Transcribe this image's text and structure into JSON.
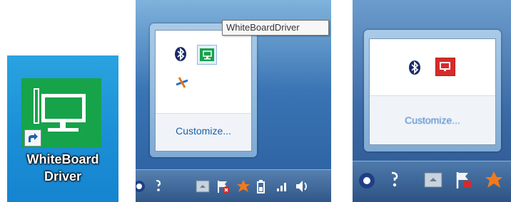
{
  "desktop_shortcut": {
    "label_line1": "WhiteBoard",
    "label_line2": "Driver",
    "icon": "whiteboard-monitor-icon",
    "tile_color": "#17a34a"
  },
  "tray_popup": {
    "tooltip": "WhiteBoardDriver",
    "customize_label": "Customize...",
    "icons": [
      "bluetooth-icon",
      "whiteboard-driver-icon",
      "network-tool-icon"
    ]
  },
  "tray_popup_zoom": {
    "customize_label": "Customize...",
    "icons": [
      "bluetooth-icon",
      "whiteboard-driver-icon"
    ],
    "driver_icon_color": "#d62b2b"
  },
  "taskbar_icons": [
    "help-icon",
    "show-hidden-arrow-icon",
    "action-center-flag-icon",
    "avast-icon",
    "battery-icon",
    "signal-icon",
    "volume-icon"
  ],
  "colors": {
    "taskbar": "#2f5688",
    "link": "#1c5fa5"
  }
}
